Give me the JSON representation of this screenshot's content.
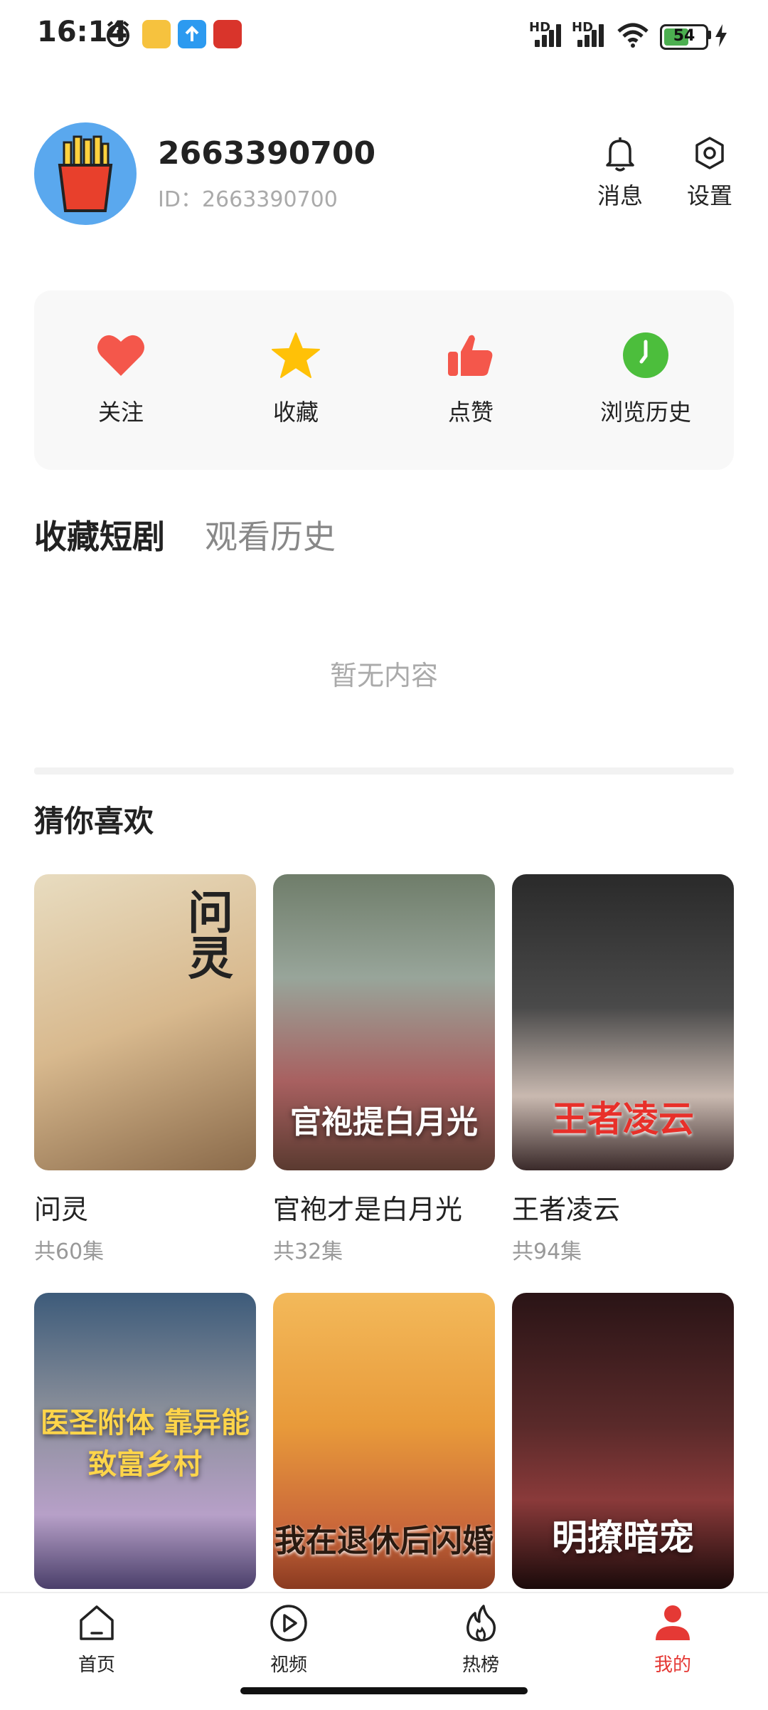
{
  "status_bar": {
    "time": "16:14",
    "battery": "54",
    "signal_label": "HD"
  },
  "profile": {
    "username": "2663390700",
    "id_text": "ID：2663390700",
    "messages_label": "消息",
    "settings_label": "设置"
  },
  "actions": [
    {
      "label": "关注",
      "icon": "heart-icon",
      "color": "#f4574b"
    },
    {
      "label": "收藏",
      "icon": "star-icon",
      "color": "#ffc107"
    },
    {
      "label": "点赞",
      "icon": "thumbs-up-icon",
      "color": "#f4574b"
    },
    {
      "label": "浏览历史",
      "icon": "clock-icon",
      "color": "#4cbe3c"
    }
  ],
  "tabs": {
    "favorites": "收藏短剧",
    "history": "观看历史"
  },
  "empty_text": "暂无内容",
  "recommend": {
    "title": "猜你喜欢",
    "items": [
      {
        "title": "问灵",
        "count": "共60集",
        "poster_text": "问灵"
      },
      {
        "title": "官袍才是白月光",
        "count": "共32集",
        "poster_text": "官袍提白月光"
      },
      {
        "title": "王者凌云",
        "count": "共94集",
        "poster_text": "王者凌云"
      },
      {
        "title": "",
        "count": "",
        "poster_text": "医圣附体 靠异能致富乡村"
      },
      {
        "title": "",
        "count": "",
        "poster_text": "我在退休后闪婚"
      },
      {
        "title": "",
        "count": "",
        "poster_text": "明撩暗宠"
      }
    ]
  },
  "bottom_nav": [
    {
      "label": "首页",
      "icon": "home-icon"
    },
    {
      "label": "视频",
      "icon": "play-circle-icon"
    },
    {
      "label": "热榜",
      "icon": "flame-icon"
    },
    {
      "label": "我的",
      "icon": "user-icon",
      "active": true
    }
  ],
  "colors": {
    "accent": "#e53935",
    "avatar_bg": "#5aa8ee"
  }
}
